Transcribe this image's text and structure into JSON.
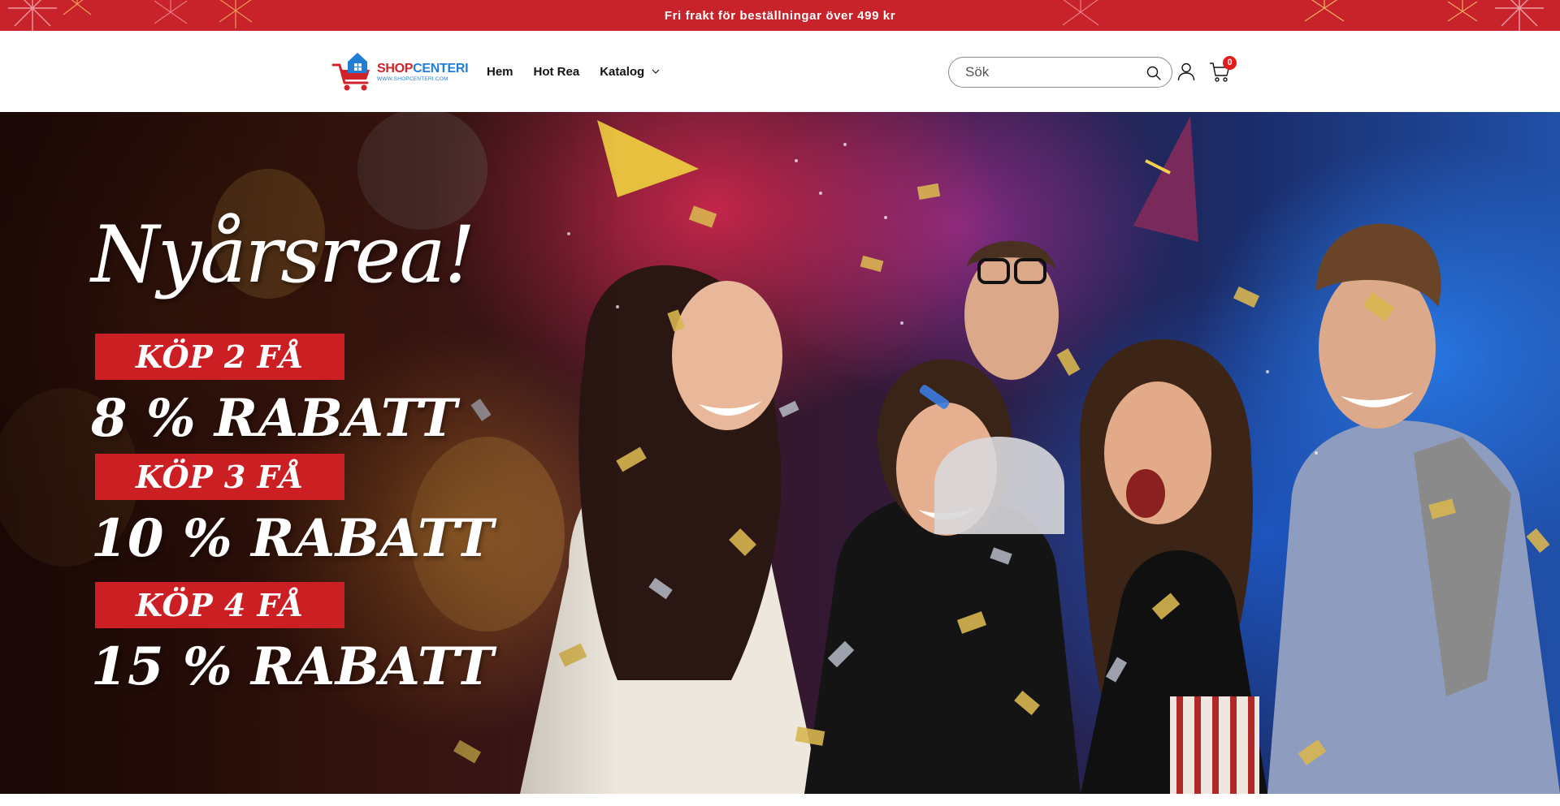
{
  "announcement": {
    "text": "Fri frakt för beställningar över 499 kr"
  },
  "header": {
    "logo": {
      "brand_part1": "SHOP",
      "brand_part2": "CENTERI",
      "tagline": "WWW.SHOPCENTERI.COM"
    },
    "nav": [
      {
        "label": "Hem"
      },
      {
        "label": "Hot Rea"
      },
      {
        "label": "Katalog",
        "has_dropdown": true
      }
    ],
    "search": {
      "placeholder": "Sök",
      "icon": "search-icon"
    },
    "account_icon": "account-icon",
    "cart": {
      "icon": "cart-icon",
      "count": "0"
    }
  },
  "hero": {
    "script_title": "Nyårsrea!",
    "promos": [
      {
        "tag": "KÖP 2 FÅ",
        "discount": "8 % RABATT"
      },
      {
        "tag": "KÖP 3 FÅ",
        "discount": "10 % RABATT"
      },
      {
        "tag": "KÖP 4 FÅ",
        "discount": "15 % RABATT"
      }
    ]
  },
  "colors": {
    "announcement_bg": "#c8222a",
    "promo_tag_bg": "#cc1f24",
    "cart_badge": "#e21b1b",
    "logo_red": "#d1232a",
    "logo_blue": "#1f7ed6"
  }
}
